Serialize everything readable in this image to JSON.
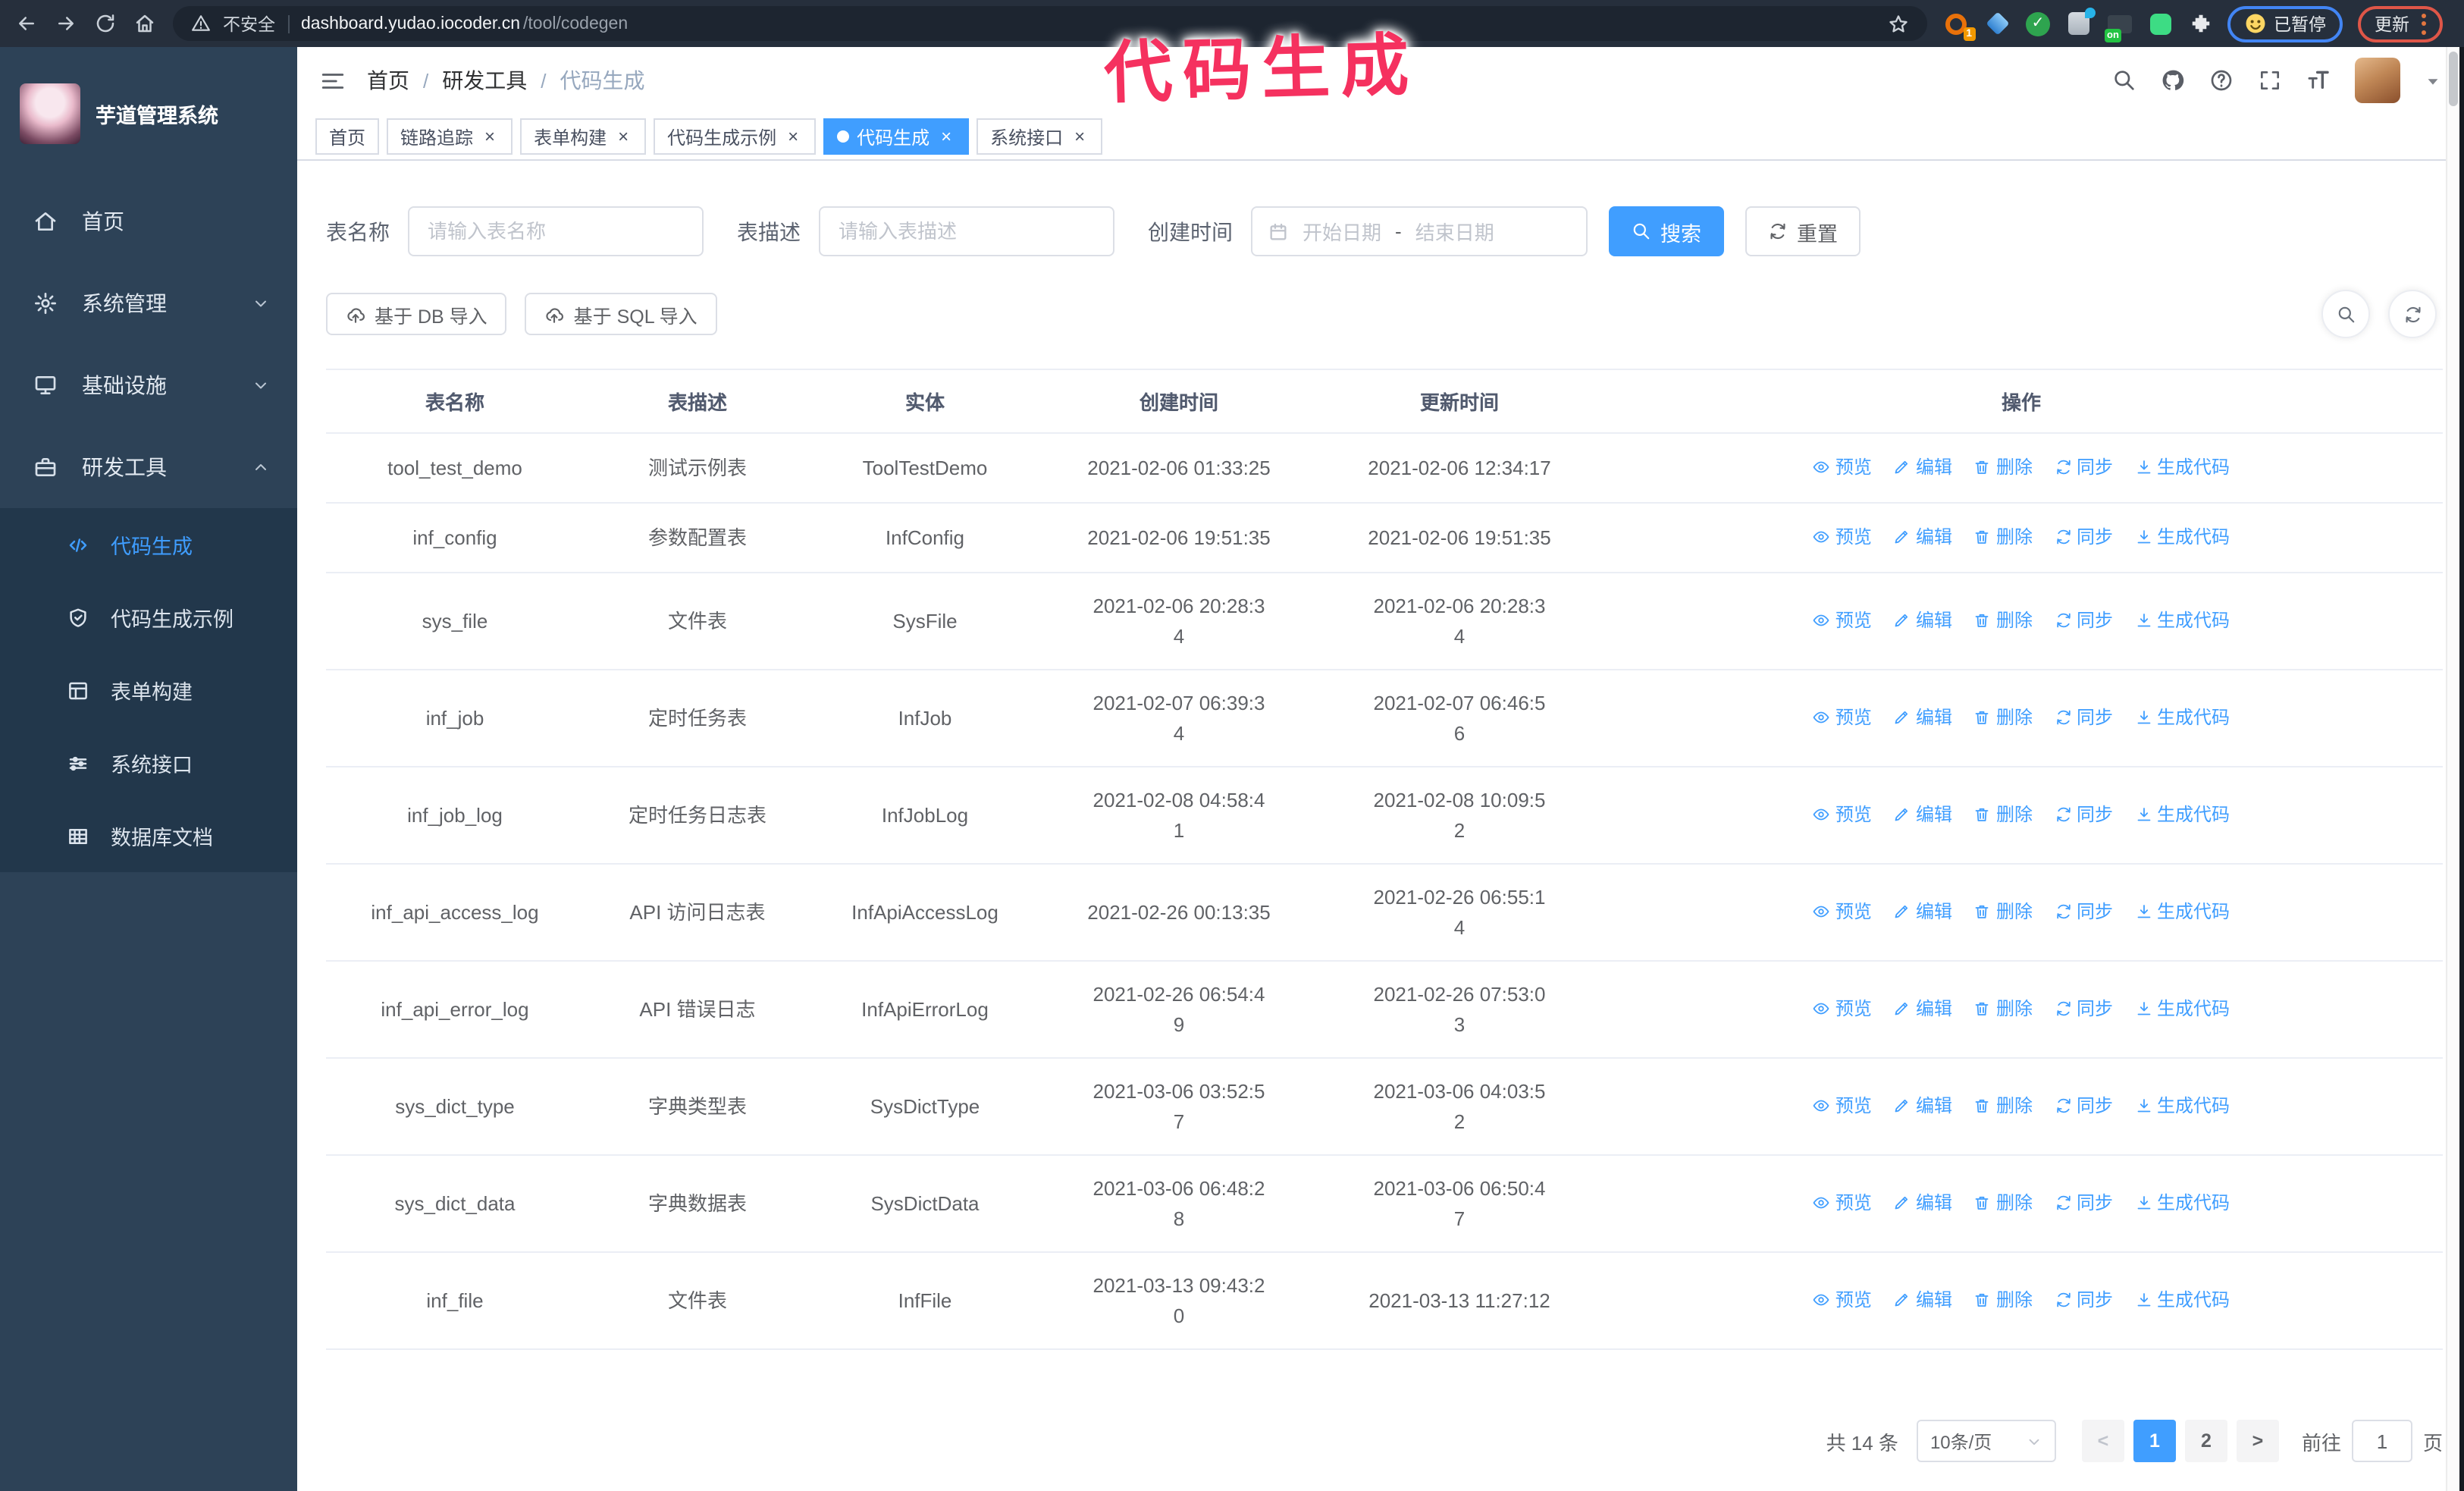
{
  "browser": {
    "security_label": "不安全",
    "url_host": "dashboard.yudao.iocoder.cn",
    "url_path": "/tool/codegen",
    "extension_badge": "1",
    "on_badge": "on",
    "paused_label": "已暂停",
    "update_label": "更新"
  },
  "annotation": {
    "text": "代码生成",
    "color": "#f5315f"
  },
  "sidebar": {
    "title": "芋道管理系统",
    "items": [
      {
        "label": "首页",
        "icon": "home-icon"
      },
      {
        "label": "系统管理",
        "icon": "gear-icon",
        "expandable": true
      },
      {
        "label": "基础设施",
        "icon": "monitor-icon",
        "expandable": true
      },
      {
        "label": "研发工具",
        "icon": "toolbox-icon",
        "expanded": true
      }
    ],
    "subitems": [
      {
        "label": "代码生成",
        "icon": "code-icon",
        "active": true
      },
      {
        "label": "代码生成示例",
        "icon": "shield-check-icon"
      },
      {
        "label": "表单构建",
        "icon": "form-icon"
      },
      {
        "label": "系统接口",
        "icon": "sliders-icon"
      },
      {
        "label": "数据库文档",
        "icon": "database-icon"
      }
    ]
  },
  "header": {
    "breadcrumb": [
      "首页",
      "研发工具",
      "代码生成"
    ],
    "breadcrumb_separator": "/"
  },
  "tabs": {
    "close_glyph": "×",
    "items": [
      {
        "label": "首页",
        "closable": false,
        "active": false
      },
      {
        "label": "链路追踪",
        "closable": true,
        "active": false
      },
      {
        "label": "表单构建",
        "closable": true,
        "active": false
      },
      {
        "label": "代码生成示例",
        "closable": true,
        "active": false
      },
      {
        "label": "代码生成",
        "closable": true,
        "active": true
      },
      {
        "label": "系统接口",
        "closable": true,
        "active": false
      }
    ]
  },
  "filters": {
    "table_name_label": "表名称",
    "table_name_placeholder": "请输入表名称",
    "table_desc_label": "表描述",
    "table_desc_placeholder": "请输入表描述",
    "create_time_label": "创建时间",
    "date_start_placeholder": "开始日期",
    "date_separator": "-",
    "date_end_placeholder": "结束日期",
    "search_label": "搜索",
    "reset_label": "重置"
  },
  "toolbar": {
    "import_db_label": "基于 DB 导入",
    "import_sql_label": "基于 SQL 导入"
  },
  "table": {
    "columns": [
      "表名称",
      "表描述",
      "实体",
      "创建时间",
      "更新时间",
      "操作"
    ],
    "actions": [
      "预览",
      "编辑",
      "删除",
      "同步",
      "生成代码"
    ],
    "action_icons": [
      "eye-icon",
      "edit-icon",
      "delete-icon",
      "sync-icon",
      "download-icon"
    ],
    "rows": [
      {
        "name": "tool_test_demo",
        "desc": "测试示例表",
        "entity": "ToolTestDemo",
        "create_time": "2021-02-06 01:33:25",
        "update_time": "2021-02-06 12:34:17"
      },
      {
        "name": "inf_config",
        "desc": "参数配置表",
        "entity": "InfConfig",
        "create_time": "2021-02-06 19:51:35",
        "update_time": "2021-02-06 19:51:35"
      },
      {
        "name": "sys_file",
        "desc": "文件表",
        "entity": "SysFile",
        "create_time": "2021-02-06 20:28:3\n4",
        "update_time": "2021-02-06 20:28:3\n4"
      },
      {
        "name": "inf_job",
        "desc": "定时任务表",
        "entity": "InfJob",
        "create_time": "2021-02-07 06:39:3\n4",
        "update_time": "2021-02-07 06:46:5\n6"
      },
      {
        "name": "inf_job_log",
        "desc": "定时任务日志表",
        "entity": "InfJobLog",
        "create_time": "2021-02-08 04:58:4\n1",
        "update_time": "2021-02-08 10:09:5\n2"
      },
      {
        "name": "inf_api_access_log",
        "desc": "API 访问日志表",
        "entity": "InfApiAccessLog",
        "create_time": "2021-02-26 00:13:35",
        "update_time": "2021-02-26 06:55:1\n4"
      },
      {
        "name": "inf_api_error_log",
        "desc": "API 错误日志",
        "entity": "InfApiErrorLog",
        "create_time": "2021-02-26 06:54:4\n9",
        "update_time": "2021-02-26 07:53:0\n3"
      },
      {
        "name": "sys_dict_type",
        "desc": "字典类型表",
        "entity": "SysDictType",
        "create_time": "2021-03-06 03:52:5\n7",
        "update_time": "2021-03-06 04:03:5\n2"
      },
      {
        "name": "sys_dict_data",
        "desc": "字典数据表",
        "entity": "SysDictData",
        "create_time": "2021-03-06 06:48:2\n8",
        "update_time": "2021-03-06 06:50:4\n7"
      },
      {
        "name": "inf_file",
        "desc": "文件表",
        "entity": "InfFile",
        "create_time": "2021-03-13 09:43:2\n0",
        "update_time": "2021-03-13 11:27:12"
      }
    ]
  },
  "pagination": {
    "total_label": "共 14 条",
    "page_size_label": "10条/页",
    "prev_glyph": "<",
    "next_glyph": ">",
    "pages": [
      "1",
      "2"
    ],
    "active_page": "1",
    "goto_label": "前往",
    "goto_value": "1",
    "page_unit_label": "页"
  }
}
